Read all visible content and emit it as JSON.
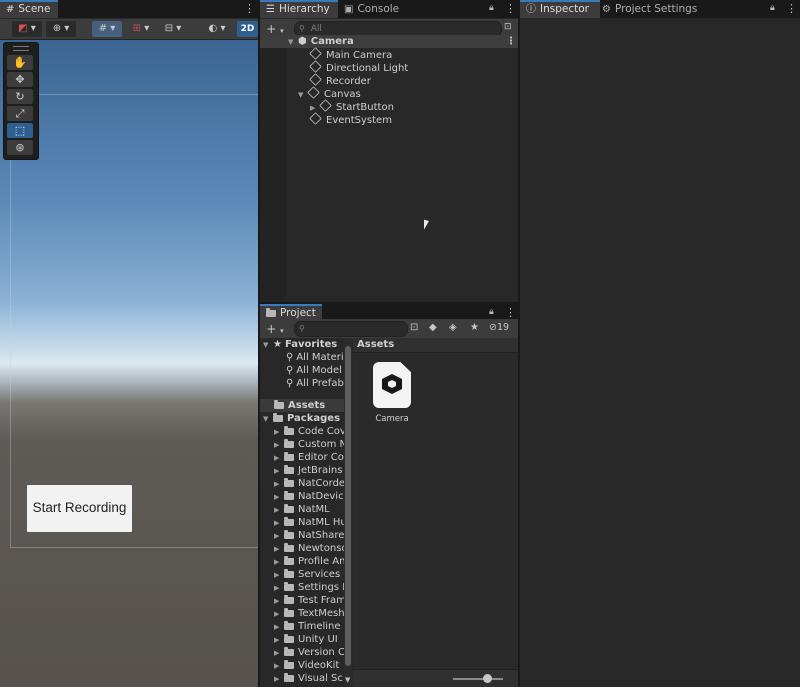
{
  "scene": {
    "tab_label": "Scene",
    "toggle_2d": "2D",
    "start_recording_label": "Start Recording",
    "tools": [
      "hand-tool",
      "move-tool",
      "rotate-tool",
      "scale-tool",
      "rect-tool",
      "transform-tool"
    ],
    "tools_active": "rect-tool"
  },
  "hierarchy": {
    "tab_label": "Hierarchy",
    "console_tab_label": "Console",
    "search_placeholder": "All",
    "root": "Camera",
    "items": [
      {
        "label": "Main Camera",
        "depth": 1
      },
      {
        "label": "Directional Light",
        "depth": 1
      },
      {
        "label": "Recorder",
        "depth": 1
      },
      {
        "label": "Canvas",
        "depth": 1,
        "expanded": true
      },
      {
        "label": "StartButton",
        "depth": 2,
        "collapsed": true
      },
      {
        "label": "EventSystem",
        "depth": 1
      }
    ]
  },
  "project": {
    "tab_label": "Project",
    "hidden_count": "19",
    "favorites_label": "Favorites",
    "favorites": [
      "All Materi",
      "All Model",
      "All Prefab"
    ],
    "assets_label": "Assets",
    "packages_label": "Packages",
    "packages": [
      "Code Cov",
      "Custom N",
      "Editor Cor",
      "JetBrains",
      "NatCorde",
      "NatDevic",
      "NatML",
      "NatML Hu",
      "NatShare",
      "Newtonso",
      "Profile An",
      "Services",
      "Settings M",
      "Test Fram",
      "TextMesh",
      "Timeline",
      "Unity UI",
      "Version C",
      "VideoKit",
      "Visual Sc"
    ],
    "breadcrumb": "Assets",
    "asset_item": "Camera"
  },
  "inspector": {
    "tab_label": "Inspector",
    "settings_tab_label": "Project Settings"
  },
  "colors": {
    "accent": "#3a79bb",
    "panel_bg": "#282828",
    "toolbar_bg": "#3c3c3c"
  }
}
